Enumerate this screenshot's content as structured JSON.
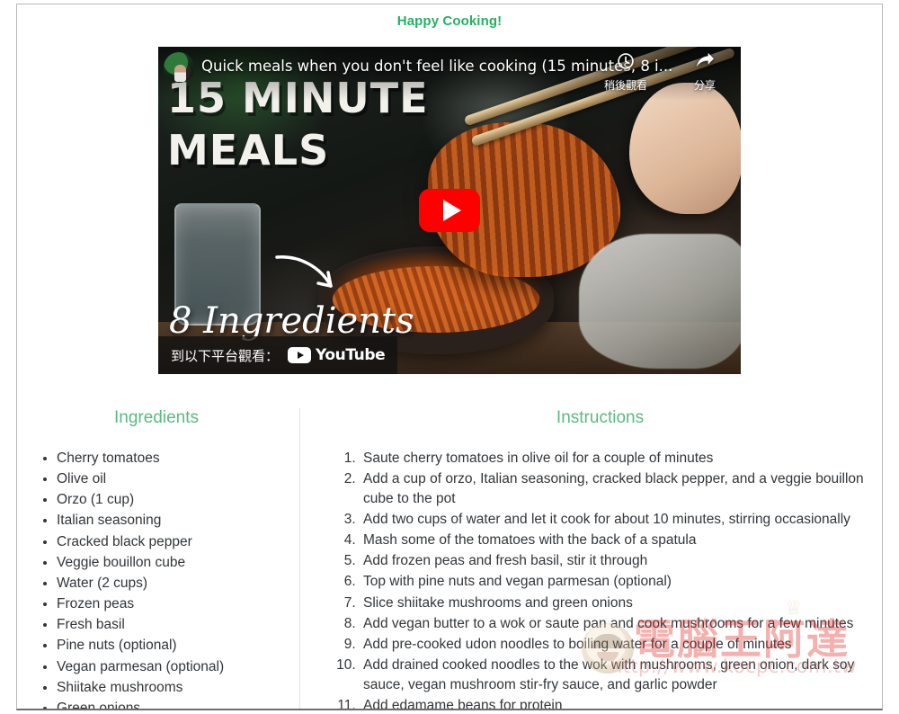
{
  "page": {
    "title": "Happy Cooking!",
    "title_color": "#24b263",
    "heading_color": "#5cb885"
  },
  "video": {
    "player": "youtube-embed",
    "video_title": "Quick meals when you don't feel like cooking (15 minutes, 8 i...",
    "thumbnail_title_line1": "15 MINUTE",
    "thumbnail_title_line2": "MEALS",
    "thumbnail_subtitle": "8 Ingredients",
    "watch_on_label": "到以下平台觀看：",
    "platform_name": "YouTube",
    "actions": [
      {
        "icon": "clock-icon",
        "label": "稍後觀看"
      },
      {
        "icon": "share-arrow-icon",
        "label": "分享"
      }
    ],
    "play_button_label": "播放",
    "play_button_color": "#ff0000"
  },
  "ingredients": {
    "heading": "Ingredients",
    "items": [
      "Cherry tomatoes",
      "Olive oil",
      "Orzo (1 cup)",
      "Italian seasoning",
      "Cracked black pepper",
      "Veggie bouillon cube",
      "Water (2 cups)",
      "Frozen peas",
      "Fresh basil",
      "Pine nuts (optional)",
      "Vegan parmesan (optional)",
      "Shiitake mushrooms",
      "Green onions"
    ]
  },
  "instructions": {
    "heading": "Instructions",
    "steps": [
      "Saute cherry tomatoes in olive oil for a couple of minutes",
      "Add a cup of orzo, Italian seasoning, cracked black pepper, and a veggie bouillon cube to the pot",
      "Add two cups of water and let it cook for about 10 minutes, stirring occasionally",
      "Mash some of the tomatoes with the back of a spatula",
      "Add frozen peas and fresh basil, stir it through",
      "Top with pine nuts and vegan parmesan (optional)",
      "Slice shiitake mushrooms and green onions",
      "Add vegan butter to a wok or saute pan and cook mushrooms for a few minutes",
      "Add pre-cooked udon noodles to boiling water for a couple of minutes",
      "Add drained cooked noodles to the wok with mushrooms, green onion, dark soy sauce, vegan mushroom stir-fry sauce, and garlic powder",
      "Add edamame beans for protein"
    ]
  },
  "watermark": {
    "brand": "電腦王阿達",
    "url": "http://www.kocpc.com.tw",
    "crown": "♕"
  }
}
